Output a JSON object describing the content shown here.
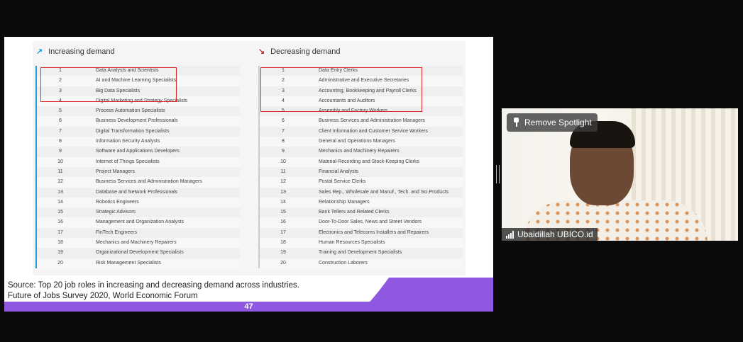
{
  "slide": {
    "increasing": {
      "title": "Increasing demand",
      "arrow": "↗",
      "items": [
        {
          "n": "1",
          "label": "Data Analysts and Scientists"
        },
        {
          "n": "2",
          "label": "AI and Machine Learning Specialists"
        },
        {
          "n": "3",
          "label": "Big Data Specialists"
        },
        {
          "n": "4",
          "label": "Digital Marketing and Strategy Specialists"
        },
        {
          "n": "5",
          "label": "Process Automation Specialists"
        },
        {
          "n": "6",
          "label": "Business Development Professionals"
        },
        {
          "n": "7",
          "label": "Digital Transformation Specialists"
        },
        {
          "n": "8",
          "label": "Information Security Analysts"
        },
        {
          "n": "9",
          "label": "Software and Applications Developers"
        },
        {
          "n": "10",
          "label": "Internet of Things Specialists"
        },
        {
          "n": "11",
          "label": "Project Managers"
        },
        {
          "n": "12",
          "label": "Business Services and Administration Managers"
        },
        {
          "n": "13",
          "label": "Database and Network Professionals"
        },
        {
          "n": "14",
          "label": "Robotics Engineers"
        },
        {
          "n": "15",
          "label": "Strategic Advisors"
        },
        {
          "n": "16",
          "label": "Management and Organization Analysts"
        },
        {
          "n": "17",
          "label": "FinTech Engineers"
        },
        {
          "n": "18",
          "label": "Mechanics and Machinery Repairers"
        },
        {
          "n": "19",
          "label": "Organizational Development Specialists"
        },
        {
          "n": "20",
          "label": "Risk Management Specialists"
        }
      ]
    },
    "decreasing": {
      "title": "Decreasing demand",
      "arrow": "↘",
      "items": [
        {
          "n": "1",
          "label": "Data Entry Clerks"
        },
        {
          "n": "2",
          "label": "Administrative and Executive Secretaries"
        },
        {
          "n": "3",
          "label": "Accounting,  Bookkeeping and Payroll Clerks"
        },
        {
          "n": "4",
          "label": "Accountants and Auditors"
        },
        {
          "n": "5",
          "label": "Assembly and Factory Workers"
        },
        {
          "n": "6",
          "label": "Business Services and Administration Managers"
        },
        {
          "n": "7",
          "label": "Client Information and Customer Service Workers"
        },
        {
          "n": "8",
          "label": "General and Operations Managers"
        },
        {
          "n": "9",
          "label": "Mechanics and Machinery Repairers"
        },
        {
          "n": "10",
          "label": "Material-Recording and Stock-Keeping Clerks"
        },
        {
          "n": "11",
          "label": "Financial Analysts"
        },
        {
          "n": "12",
          "label": "Postal Service Clerks"
        },
        {
          "n": "13",
          "label": "Sales Rep., Wholesale and Manuf., Tech. and Sci.Products"
        },
        {
          "n": "14",
          "label": "Relationship Managers"
        },
        {
          "n": "15",
          "label": "Bank Tellers and Related Clerks"
        },
        {
          "n": "16",
          "label": "Door-To-Door Sales, News and Street Vendors"
        },
        {
          "n": "17",
          "label": "Electronics and Telecoms Installers and Repairers"
        },
        {
          "n": "18",
          "label": "Human Resources Specialists"
        },
        {
          "n": "19",
          "label": "Training and Development Specialists"
        },
        {
          "n": "20",
          "label": "Construction Laborers"
        }
      ]
    },
    "source_line1": "Source: Top 20 job roles in increasing and decreasing demand across industries.",
    "source_line2": "Future of Jobs Survey 2020, World Economic Forum",
    "page_number": "47"
  },
  "video": {
    "spotlight_button": "Remove Spotlight",
    "participant_name": "Ubaidillah UBICO.id"
  },
  "colors": {
    "increase_accent": "#1e9bd7",
    "decrease_accent": "#c0282d",
    "highlight_box": "#e0262b",
    "footer_purple": "#8e58e0"
  }
}
